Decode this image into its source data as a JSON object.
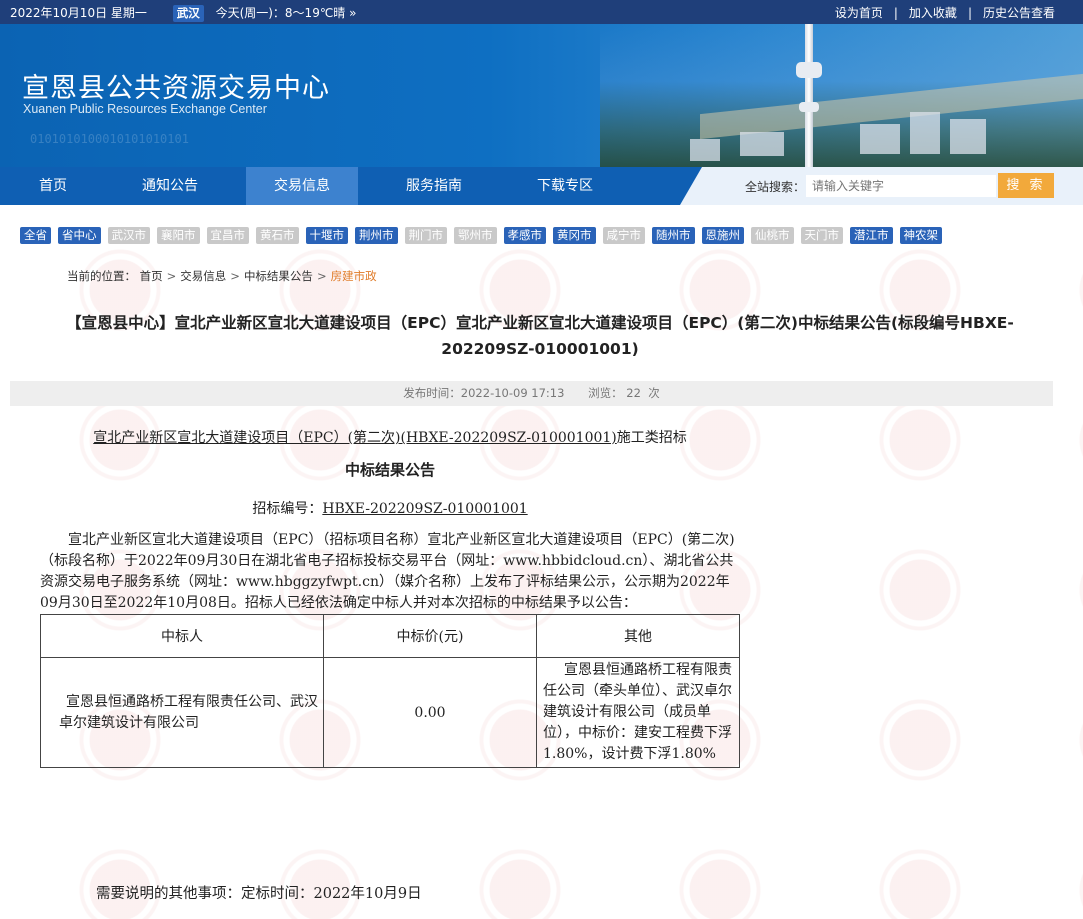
{
  "topbar": {
    "date": "2022年10月10日 星期一",
    "city": "武汉",
    "weather": "今天(周一)：8～19℃晴 »",
    "links": [
      "设为首页",
      "加入收藏",
      "历史公告查看"
    ]
  },
  "banner": {
    "title_cn": "宣恩县公共资源交易中心",
    "title_en": "Xuanen Public Resources Exchange Center"
  },
  "nav": {
    "items": [
      "首页",
      "通知公告",
      "交易信息",
      "服务指南",
      "下载专区"
    ],
    "active": "交易信息"
  },
  "search": {
    "label": "全站搜索：",
    "placeholder": "请输入关键字",
    "button": "搜 索"
  },
  "cities": [
    {
      "name": "全省",
      "active": true
    },
    {
      "name": "省中心",
      "active": true
    },
    {
      "name": "武汉市",
      "active": false
    },
    {
      "name": "襄阳市",
      "active": false
    },
    {
      "name": "宜昌市",
      "active": false
    },
    {
      "name": "黄石市",
      "active": false
    },
    {
      "name": "十堰市",
      "active": true
    },
    {
      "name": "荆州市",
      "active": true
    },
    {
      "name": "荆门市",
      "active": false
    },
    {
      "name": "鄂州市",
      "active": false
    },
    {
      "name": "孝感市",
      "active": true
    },
    {
      "name": "黄冈市",
      "active": true
    },
    {
      "name": "咸宁市",
      "active": false
    },
    {
      "name": "随州市",
      "active": true
    },
    {
      "name": "恩施州",
      "active": true
    },
    {
      "name": "仙桃市",
      "active": false
    },
    {
      "name": "天门市",
      "active": false
    },
    {
      "name": "潜江市",
      "active": true
    },
    {
      "name": "神农架",
      "active": true
    }
  ],
  "breadcrumb": {
    "label": "当前的位置：",
    "items": [
      "首页",
      "交易信息",
      "中标结果公告"
    ],
    "current": "房建市政"
  },
  "article": {
    "title": "【宣恩县中心】宣北产业新区宣北大道建设项目（EPC）宣北产业新区宣北大道建设项目（EPC）(第二次)中标结果公告(标段编号HBXE-202209SZ-010001001)",
    "publish_label": "发布时间：",
    "publish_time": "2022-10-09 17:13",
    "views_label": "浏览：",
    "views": "22",
    "views_unit": "次",
    "project_line_u": "宣北产业新区宣北大道建设项目（EPC）(第二次)(HBXE-202209SZ-010001001)",
    "project_line_rest": "施工类招标",
    "subtitle": "中标结果公告",
    "code_label": "招标编号：",
    "code_value": "HBXE-202209SZ-010001001",
    "paragraph": "宣北产业新区宣北大道建设项目（EPC）（招标项目名称）宣北产业新区宣北大道建设项目（EPC）(第二次)（标段名称）于2022年09月30日在湖北省电子招标投标交易平台（网址：www.hbbidcloud.cn）、湖北省公共资源交易电子服务系统（网址：www.hbggzyfwpt.cn）（媒介名称）上发布了评标结果公示，公示期为2022年09月30日至2022年10月08日。招标人已经依法确定中标人并对本次招标的中标结果予以公告：",
    "table": {
      "headers": [
        "中标人",
        "中标价(元)",
        "其他"
      ],
      "row": {
        "winner": "宣恩县恒通路桥工程有限责任公司、武汉卓尔建筑设计有限公司",
        "price": "0.00",
        "other": "宣恩县恒通路桥工程有限责任公司（牵头单位）、武汉卓尔建筑设计有限公司（成员单位），中标价：建安工程费下浮1.80%，设计费下浮1.80%"
      }
    },
    "note": "需要说明的其他事项：定标时间：2022年10月9日"
  },
  "colors": {
    "topbar": "#1f3f7a",
    "nav": "#0f5fb3",
    "nav_active": "#3d82cf",
    "city_active": "#2a63b8",
    "city_inactive": "#c9c9c9",
    "search_button": "#f2a93b",
    "breadcrumb_current": "#e07c2a"
  }
}
